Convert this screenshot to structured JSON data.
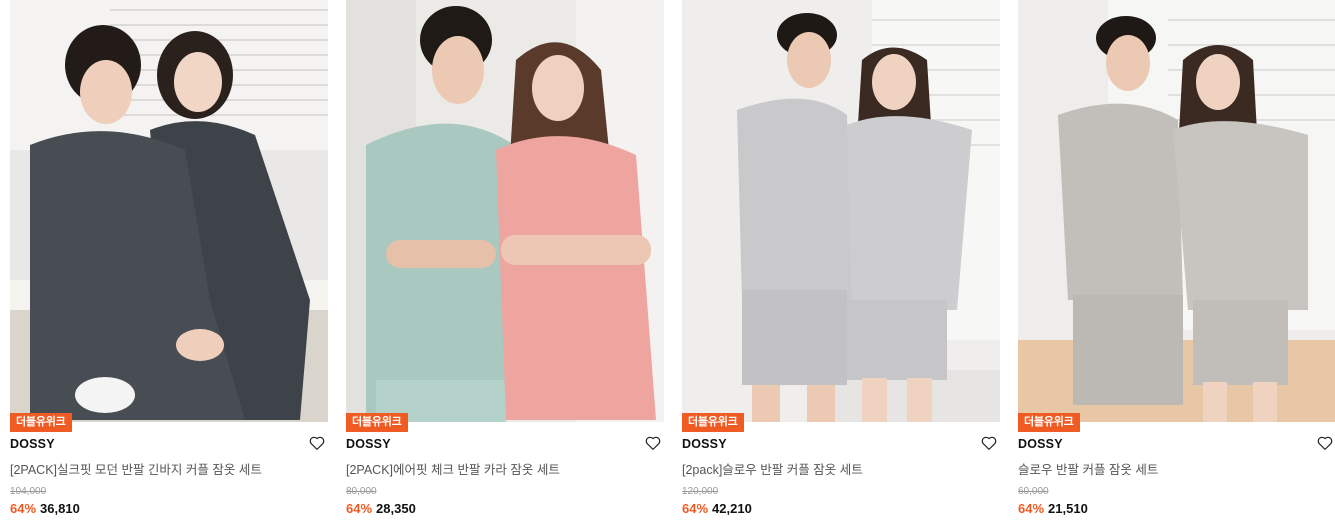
{
  "products": [
    {
      "badge": "더블유위크",
      "brand": "DOSSY",
      "title": "[2PACK]실크핏 모던 반팔 긴바지 커플 잠옷 세트",
      "original_price": "104,000",
      "discount": "64%",
      "price": "36,810",
      "image": "couple-pajama-charcoal-photo"
    },
    {
      "badge": "더블유위크",
      "brand": "DOSSY",
      "title": "[2PACK]에어핏 체크 반팔 카라 잠옷 세트",
      "original_price": "80,000",
      "discount": "64%",
      "price": "28,350",
      "image": "couple-pajama-check-photo"
    },
    {
      "badge": "더블유위크",
      "brand": "DOSSY",
      "title": "[2pack]슬로우 반팔 커플 잠옷 세트",
      "original_price": "120,000",
      "discount": "64%",
      "price": "42,210",
      "image": "couple-pajama-stripe-photo"
    },
    {
      "badge": "더블유위크",
      "brand": "DOSSY",
      "title": "슬로우 반팔 커플 잠옷 세트",
      "original_price": "60,000",
      "discount": "64%",
      "price": "21,510",
      "image": "couple-pajama-stripe-photo"
    }
  ],
  "colors": {
    "accent": "#f05a23",
    "text": "#111111",
    "muted": "#555555",
    "strike": "#9a9a9a"
  },
  "icons": {
    "wishlist": "heart-outline-icon"
  }
}
